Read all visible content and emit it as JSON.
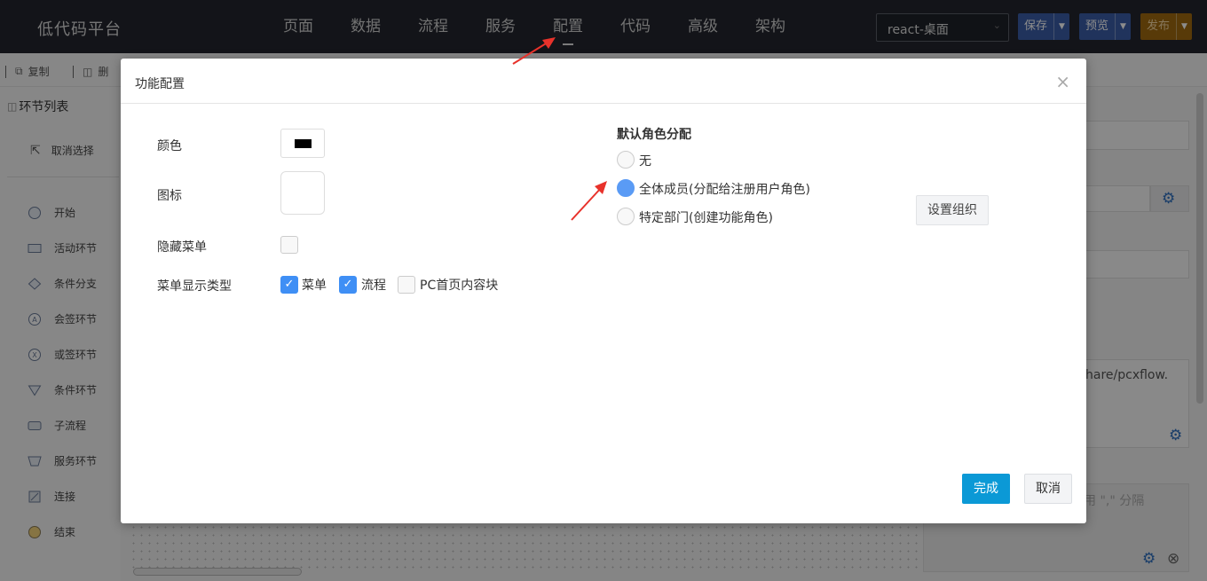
{
  "header": {
    "brand": "低代码平台",
    "nav": [
      "页面",
      "数据",
      "流程",
      "服务",
      "配置",
      "代码",
      "高级",
      "架构"
    ],
    "active_nav": "配置",
    "platform_select": "react-桌面",
    "save_label": "保存",
    "preview_label": "预览",
    "publish_label": "发布"
  },
  "toolbar": {
    "copy_label": "复制",
    "delete_label": "删"
  },
  "left_panel": {
    "title": "环节列表",
    "cancel_select": "取消选择",
    "nodes": [
      "开始",
      "活动环节",
      "条件分支",
      "会签环节",
      "或签环节",
      "条件环节",
      "子流程",
      "服务环节",
      "连接",
      "结束"
    ]
  },
  "right_panel": {
    "path_text": "/share/pcxflow.",
    "hint_text": "用 \",\" 分隔"
  },
  "modal": {
    "title": "功能配置",
    "color_label": "颜色",
    "color_value": "#000000",
    "icon_label": "图标",
    "hide_menu_label": "隐藏菜单",
    "menu_type_label": "菜单显示类型",
    "menu_type_options": [
      {
        "label": "菜单",
        "checked": true
      },
      {
        "label": "流程",
        "checked": true
      },
      {
        "label": "PC首页内容块",
        "checked": false
      }
    ],
    "role_section_title": "默认角色分配",
    "role_options": [
      {
        "label": "无",
        "selected": false
      },
      {
        "label": "全体成员(分配给注册用户角色)",
        "selected": true
      },
      {
        "label": "特定部门(创建功能角色)",
        "selected": false
      }
    ],
    "set_org_label": "设置组织",
    "done_label": "完成",
    "cancel_label": "取消"
  },
  "colors": {
    "accent": "#0b99d6",
    "radio_selected": "#5a9bf5",
    "checkbox_checked": "#3f8ff5",
    "topbar": "#23262e"
  }
}
